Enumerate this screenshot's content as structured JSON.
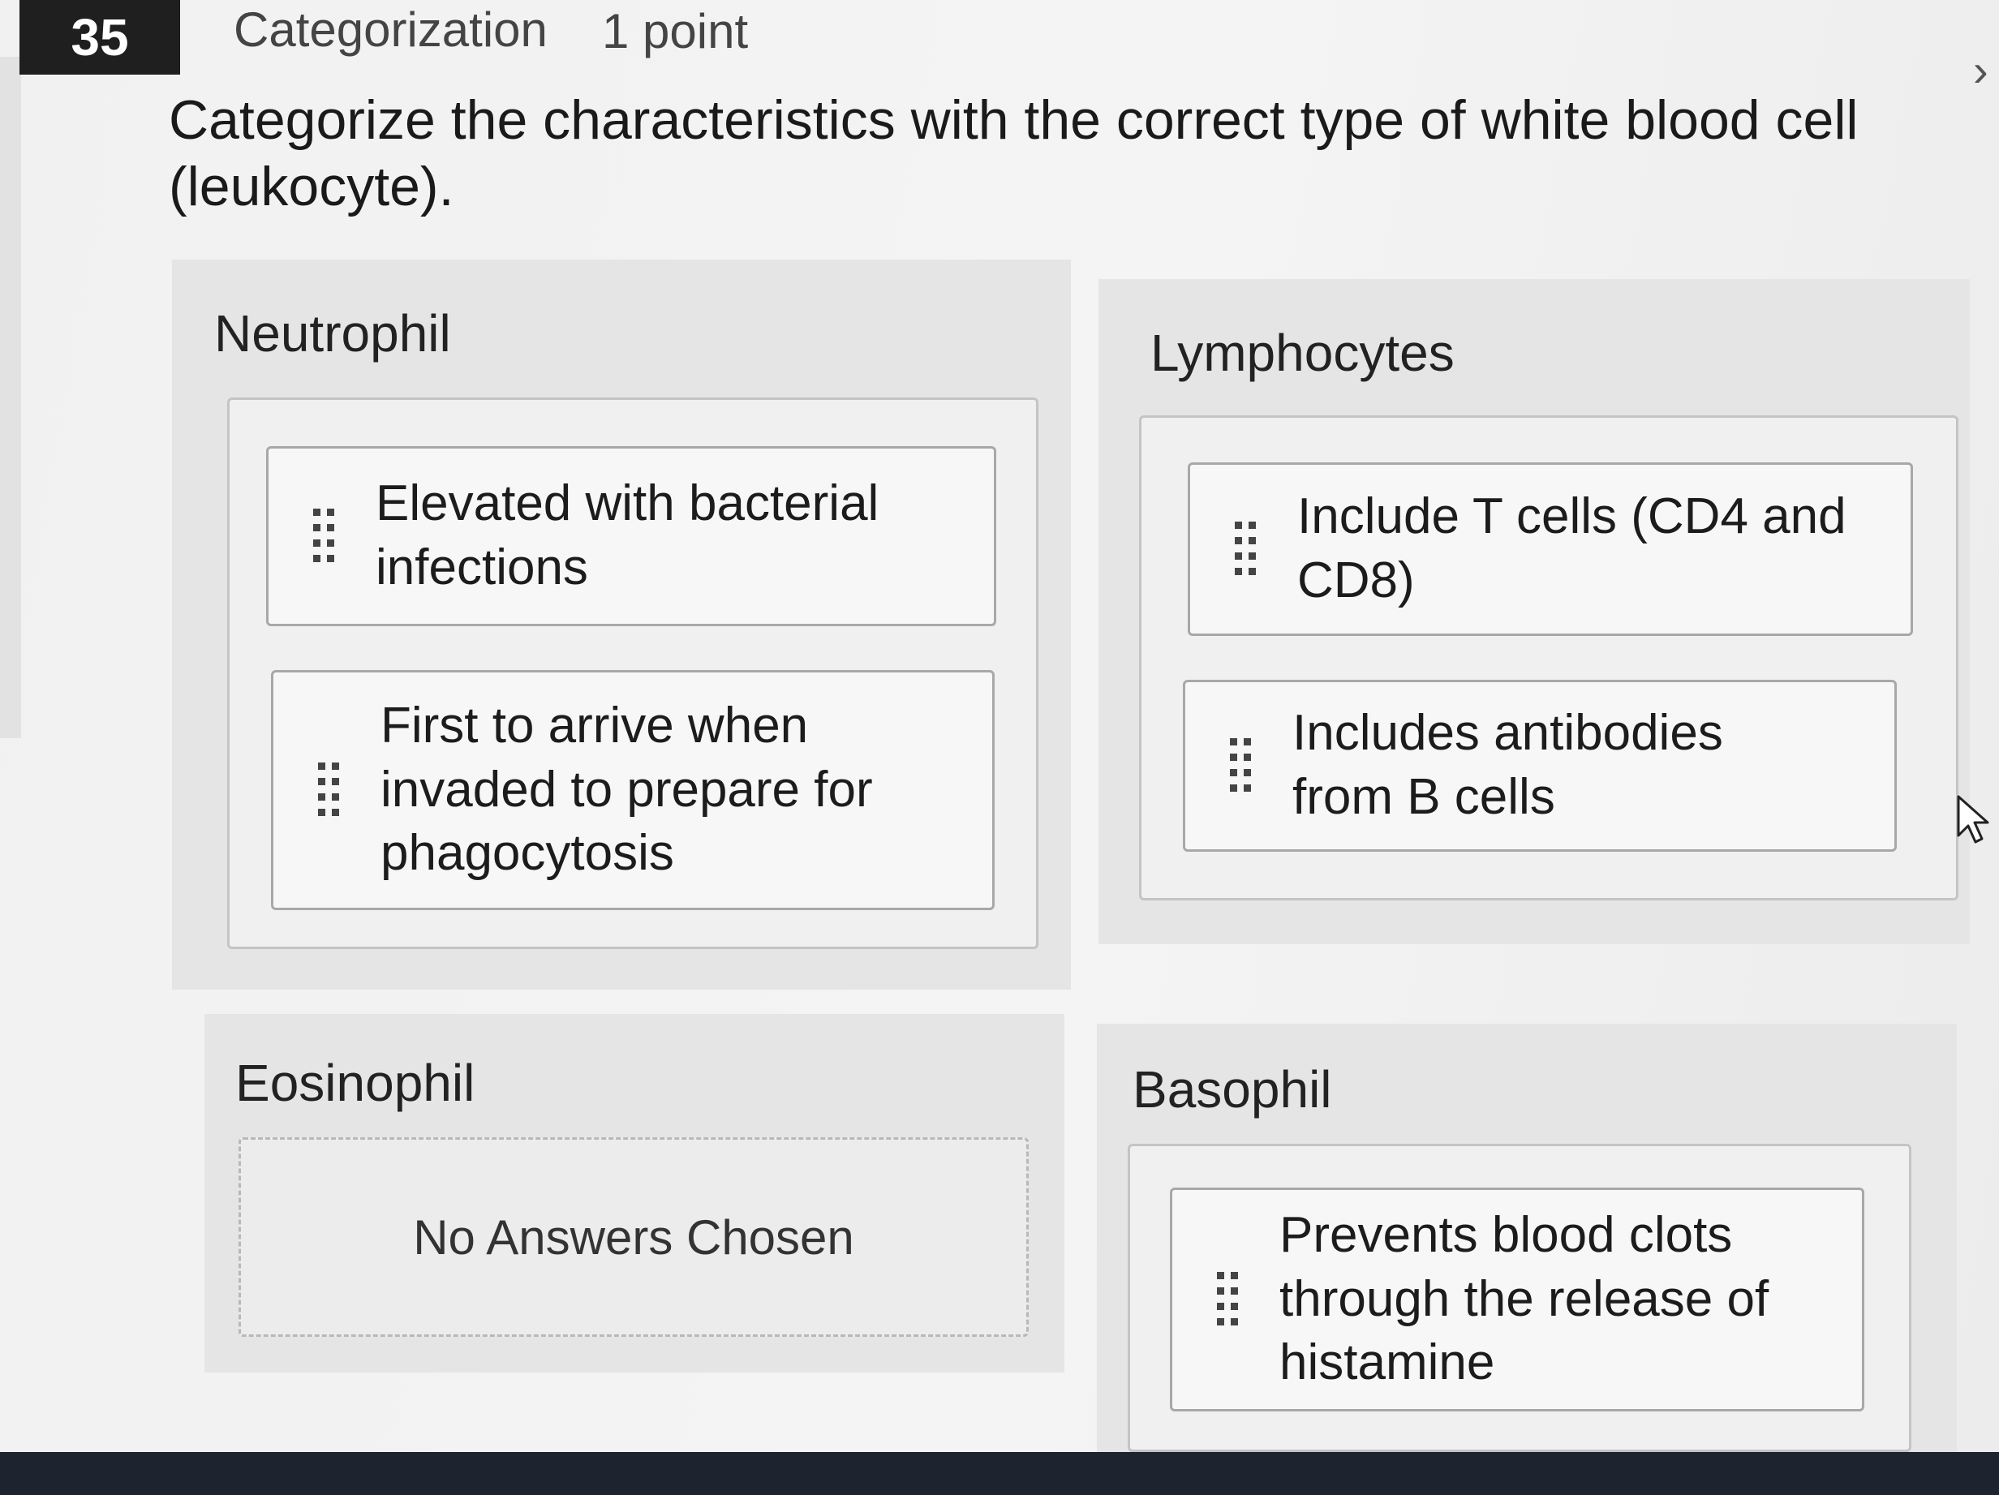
{
  "question": {
    "number": "35",
    "type": "Categorization",
    "points": "1 point",
    "prompt": "Categorize the characteristics with the correct type of white blood cell (leukocyte)."
  },
  "categories": [
    {
      "title": "Neutrophil",
      "items": [
        "Elevated with bacterial infections",
        "First to arrive when invaded to prepare for phagocytosis"
      ]
    },
    {
      "title": "Lymphocytes",
      "items": [
        "Include T cells (CD4 and CD8)",
        "Includes antibodies from B cells"
      ]
    },
    {
      "title": "Eosinophil",
      "items": [],
      "empty_text": "No Answers Chosen"
    },
    {
      "title": "Basophil",
      "items": [
        "Prevents blood clots through the release of histamine"
      ]
    }
  ],
  "icons": {
    "drag_handle": "grip-dots-icon",
    "collapse": "chevron-icon",
    "pointer": "mouse-cursor-icon"
  },
  "colors": {
    "question_number_bg": "#1f1f1f",
    "panel_bg": "#e5e5e5",
    "card_border": "#a8a8a8"
  }
}
